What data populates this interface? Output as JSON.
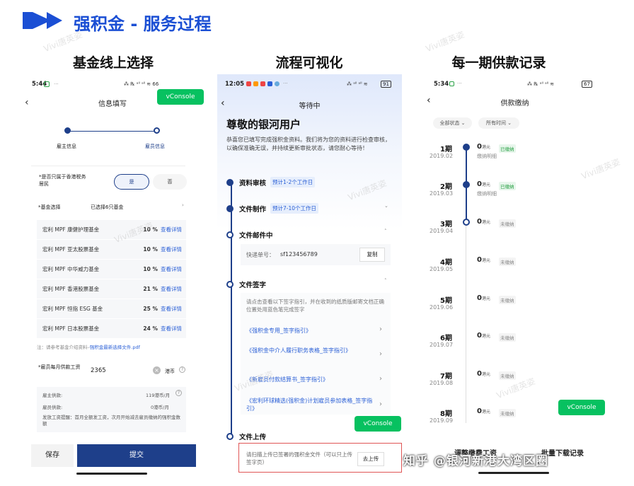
{
  "header": {
    "title": "强积金 - 服务过程"
  },
  "columns": [
    "基金线上选择",
    "流程可视化",
    "每一期供款记录"
  ],
  "watermark": "Vivi唐英姿",
  "phone1": {
    "time": "5:44",
    "status": "⁂ ℞ ᵃˡˡ ᵃˡˡ ≋ 66",
    "title": "信息填写",
    "vconsole": "vConsole",
    "steps": [
      "雇主信息",
      "雇员信息"
    ],
    "q1": "*是否只属于香港税务居民",
    "yes": "是",
    "no": "否",
    "fund_label": "*基金选择",
    "fund_value": "已选择6只基金",
    "funds": [
      {
        "name": "宏利 MPF 康健护理基金",
        "pct": "10 %",
        "detail": "查看详情"
      },
      {
        "name": "宏利 MPF 亚太股票基金",
        "pct": "10 %",
        "detail": "查看详情"
      },
      {
        "name": "宏利 MPF 中华威力基金",
        "pct": "10 %",
        "detail": "查看详情"
      },
      {
        "name": "宏利 MPF 香港股票基金",
        "pct": "21 %",
        "detail": "查看详情"
      },
      {
        "name": "宏利 MPF 恒指 ESG 基金",
        "pct": "25 %",
        "detail": "查看详情"
      },
      {
        "name": "宏利 MPF 日本股票基金",
        "pct": "24 %",
        "detail": "查看详情"
      }
    ],
    "note_prefix": "注：请参考基金介绍资料–",
    "note_link": "强积金最新选择文件.pdf",
    "salary_label": "*雇员每月供款工资",
    "salary_value": "2365",
    "salary_unit": "港币",
    "employer_label": "雇主供款:",
    "employer_value": "119港币/月",
    "employee_label": "雇员供款:",
    "employee_value": "0港币/月",
    "reminder": "发放工资提醒：首月全额发工资，次月开始减去雇员缴纳的强积金数额",
    "save": "保存",
    "submit": "提交"
  },
  "phone2": {
    "time": "12:05",
    "battery": "91",
    "title": "等待中",
    "greeting": "尊敬的银河用户",
    "intro": "恭喜您已填写完成强积金资料。我们将为您的资料进行检查审核，以确保准确无误，并持续更新审批状态，请您耐心等待！",
    "steps": [
      {
        "name": "资料审核",
        "tag": "预计1-2个工作日"
      },
      {
        "name": "文件制作",
        "tag": "预计7-10个工作日"
      },
      {
        "name": "文件邮件中",
        "tag": ""
      },
      {
        "name": "文件签字",
        "tag": ""
      },
      {
        "name": "文件上传",
        "tag": ""
      }
    ],
    "tracking_label": "快递单号：",
    "tracking_no": "sf123456789",
    "copy": "复制",
    "sign_desc": "请点击查看以下签字指引，并在收到的纸质版邮寄文档正确位置处用蓝色笔完成签字",
    "links": [
      "《强积金专用_签字指引》",
      "《强积金中介人履行职务表格_签字指引》",
      "《新雇员付款结算书_签字指引》",
      "《宏利环球精选(强积金)计划雇员参加表格_签字指引》"
    ],
    "upload_desc": "请扫描上传已签署的强积金文件（可以只上传签字页）",
    "upload_btn": "去上传",
    "vconsole": "vConsole"
  },
  "phone3": {
    "time": "5:34",
    "battery": "67",
    "title": "供款缴纳",
    "filter1": "全部状态",
    "filter2": "所有时间",
    "payments": [
      {
        "period": "1期",
        "date": "2019.02",
        "amount": "0",
        "unit": "港元",
        "status": "已缴纳",
        "detail": "缴纳明细"
      },
      {
        "period": "2期",
        "date": "2019.03",
        "amount": "0",
        "unit": "港元",
        "status": "已缴纳",
        "detail": "缴纳明细"
      },
      {
        "period": "3期",
        "date": "2019.04",
        "amount": "0",
        "unit": "港元",
        "status": "未缴纳",
        "detail": ""
      },
      {
        "period": "4期",
        "date": "2019.05",
        "amount": "0",
        "unit": "港元",
        "status": "未缴纳",
        "detail": ""
      },
      {
        "period": "5期",
        "date": "2019.06",
        "amount": "0",
        "unit": "港元",
        "status": "未缴纳",
        "detail": ""
      },
      {
        "period": "6期",
        "date": "2019.07",
        "amount": "0",
        "unit": "港元",
        "status": "未缴纳",
        "detail": ""
      },
      {
        "period": "7期",
        "date": "2019.08",
        "amount": "0",
        "unit": "港元",
        "status": "未缴纳",
        "detail": ""
      },
      {
        "period": "8期",
        "date": "2019.09",
        "amount": "0",
        "unit": "港元",
        "status": "未缴纳",
        "detail": ""
      }
    ],
    "btn_left": "调整缴费工资",
    "btn_right": "批量下载记录",
    "vconsole": "vConsole",
    "overlay": "知乎 @银河新港大湾区圈"
  },
  "colors": {
    "brand": "#1b4fd4",
    "green": "#07c160",
    "navy": "#1e3f8a"
  }
}
